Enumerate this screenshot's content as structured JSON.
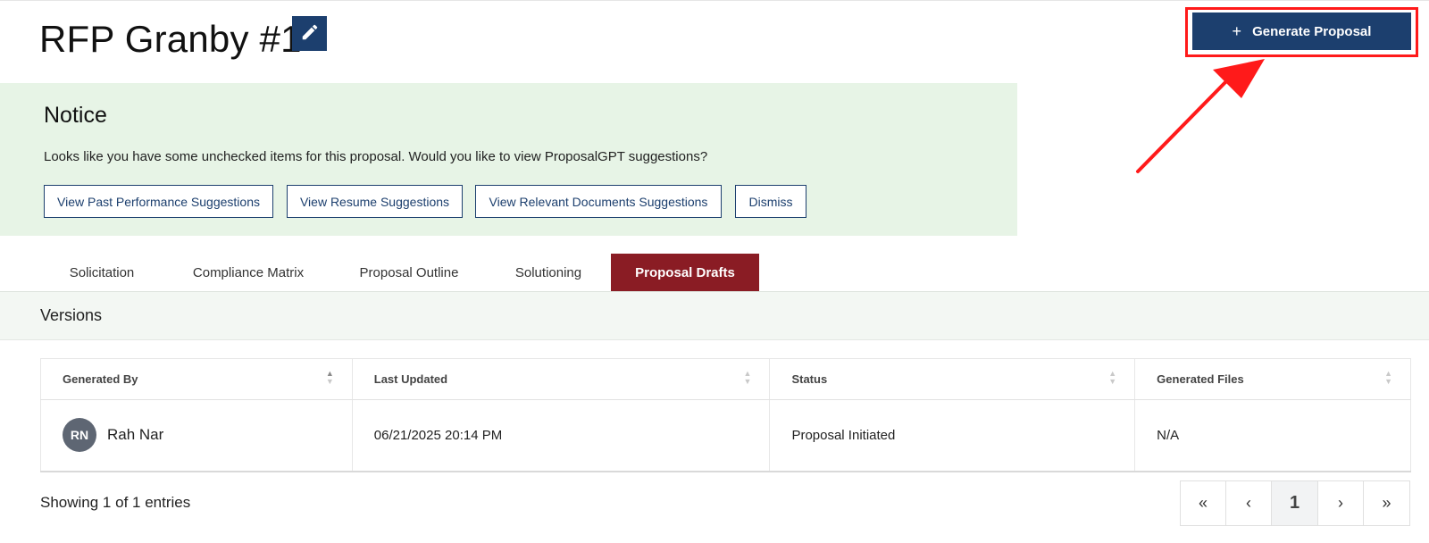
{
  "header": {
    "title": "RFP Granby #1",
    "generate_label": "Generate Proposal",
    "accent_color": "#1c3f6e"
  },
  "notice": {
    "title": "Notice",
    "message": "Looks like you have some unchecked items for this proposal. Would you like to view ProposalGPT suggestions?",
    "buttons": [
      "View Past Performance Suggestions",
      "View Resume Suggestions",
      "View Relevant Documents Suggestions",
      "Dismiss"
    ],
    "background_color": "#e7f4e6"
  },
  "tabs": [
    {
      "label": "Solicitation",
      "active": false
    },
    {
      "label": "Compliance Matrix",
      "active": false
    },
    {
      "label": "Proposal Outline",
      "active": false
    },
    {
      "label": "Solutioning",
      "active": false
    },
    {
      "label": "Proposal Drafts",
      "active": true
    }
  ],
  "active_tab_color": "#8a1c24",
  "versions": {
    "title": "Versions",
    "columns": [
      "Generated By",
      "Last Updated",
      "Status",
      "Generated Files"
    ],
    "rows": [
      {
        "initials": "RN",
        "generated_by": "Rah Nar",
        "last_updated": "06/21/2025 20:14 PM",
        "status": "Proposal Initiated",
        "generated_files": "N/A"
      }
    ]
  },
  "footer": {
    "showing": "Showing 1 of 1 entries",
    "pager": [
      "«",
      "‹",
      "1",
      "›",
      "»"
    ],
    "current_page": "1"
  },
  "icons": {
    "edit": "pencil-icon",
    "plus": "plus-icon",
    "annotation": "red-arrow-annotation"
  }
}
